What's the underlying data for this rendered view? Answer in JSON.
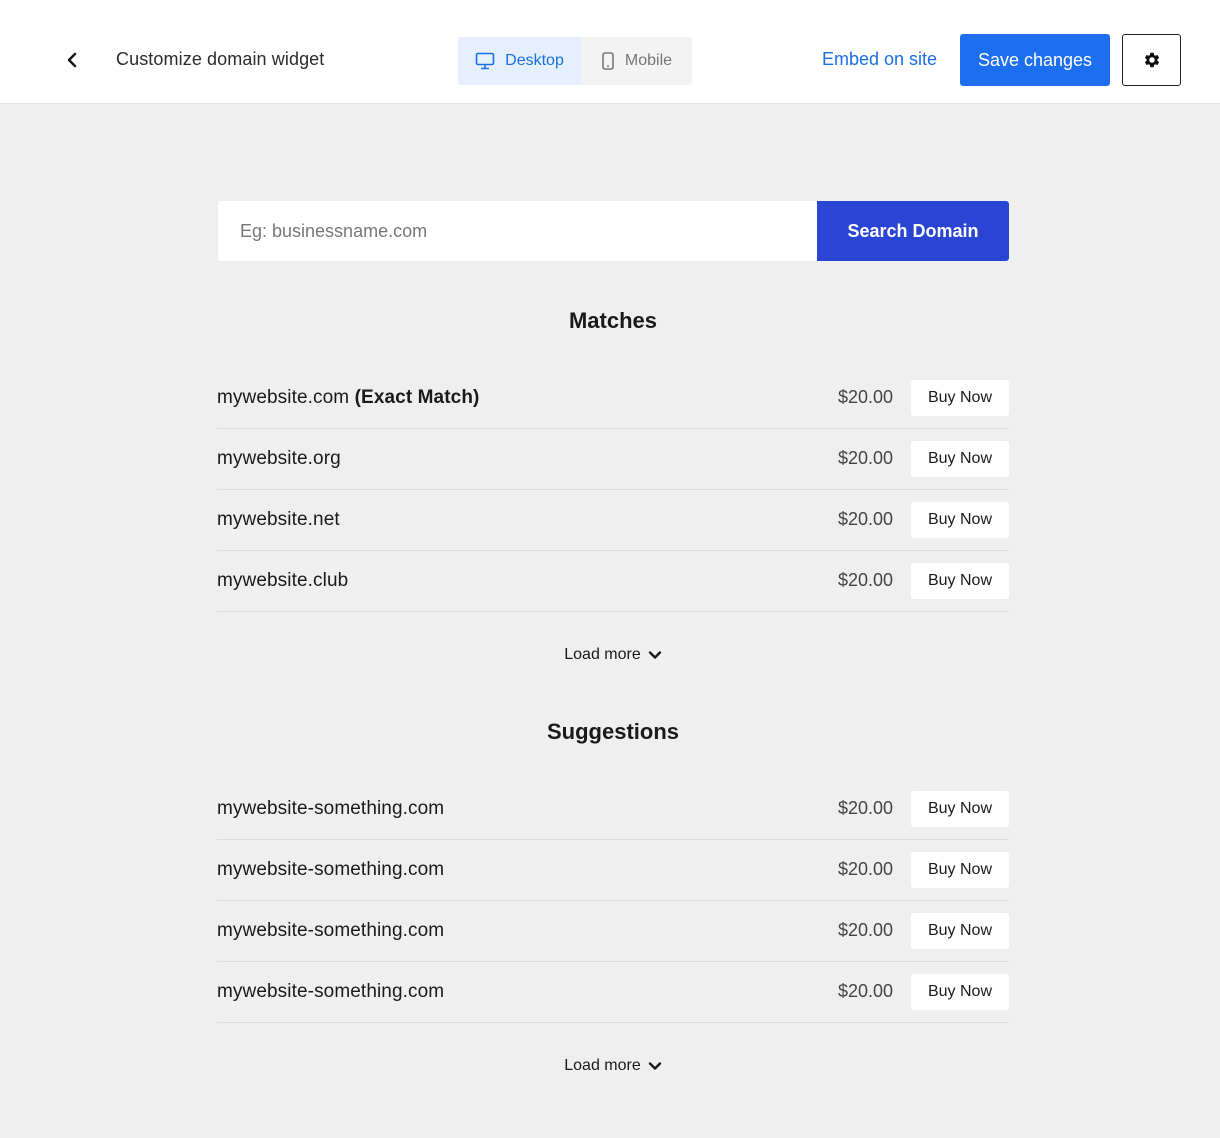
{
  "header": {
    "title": "Customize domain widget",
    "device_options": [
      {
        "label": "Desktop",
        "selected": true
      },
      {
        "label": "Mobile",
        "selected": false
      }
    ],
    "embed_label": "Embed on site",
    "save_label": "Save changes"
  },
  "search": {
    "placeholder": "Eg: businessname.com",
    "value": "",
    "button_label": "Search Domain"
  },
  "matches": {
    "title": "Matches",
    "items": [
      {
        "domain": "mywebsite.com",
        "tag": "(Exact Match)",
        "price": "$20.00",
        "button": "Buy Now"
      },
      {
        "domain": "mywebsite.org",
        "tag": "",
        "price": "$20.00",
        "button": "Buy Now"
      },
      {
        "domain": "mywebsite.net",
        "tag": "",
        "price": "$20.00",
        "button": "Buy Now"
      },
      {
        "domain": "mywebsite.club",
        "tag": "",
        "price": "$20.00",
        "button": "Buy Now"
      }
    ],
    "load_more": "Load more"
  },
  "suggestions": {
    "title": "Suggestions",
    "items": [
      {
        "domain": "mywebsite-something.com",
        "price": "$20.00",
        "button": "Buy Now"
      },
      {
        "domain": "mywebsite-something.com",
        "price": "$20.00",
        "button": "Buy Now"
      },
      {
        "domain": "mywebsite-something.com",
        "price": "$20.00",
        "button": "Buy Now"
      },
      {
        "domain": "mywebsite-something.com",
        "price": "$20.00",
        "button": "Buy Now"
      }
    ],
    "load_more": "Load more"
  },
  "colors": {
    "accent": "#1d6fef",
    "search_button": "#2a44d4",
    "background": "#efefef"
  },
  "icons": [
    "chevron-left-icon",
    "desktop-icon",
    "mobile-icon",
    "gear-icon",
    "chevron-down-icon"
  ]
}
